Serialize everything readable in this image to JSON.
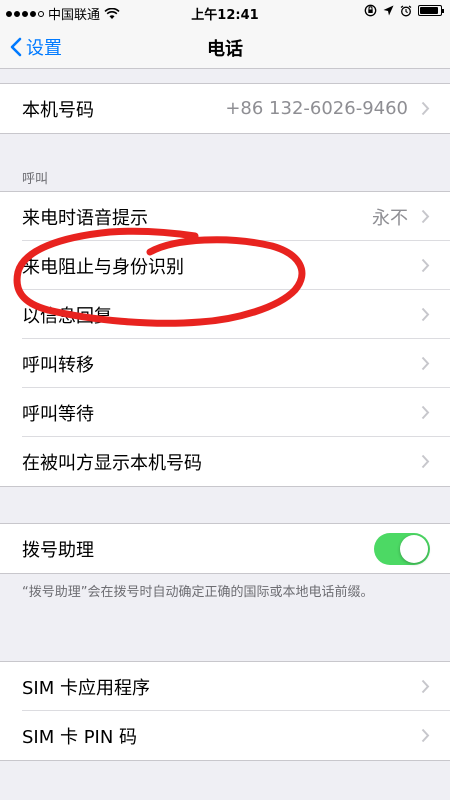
{
  "status_bar": {
    "carrier": "中国联通",
    "time": "上午12:41",
    "battery_level": 0.9
  },
  "nav": {
    "back_label": "设置",
    "title": "电话"
  },
  "my_number": {
    "label": "本机号码",
    "value": "+86 132-6026-9460"
  },
  "calls": {
    "header": "呼叫",
    "rows": [
      {
        "label": "来电时语音提示",
        "value": "永不"
      },
      {
        "label": "来电阻止与身份识别"
      },
      {
        "label": "以信息回复"
      },
      {
        "label": "呼叫转移"
      },
      {
        "label": "呼叫等待"
      },
      {
        "label": "在被叫方显示本机号码"
      }
    ]
  },
  "dial_assist": {
    "label": "拨号助理",
    "enabled": true,
    "footnote": "“拨号助理”会在拨号时自动确定正确的国际或本地电话前缀。"
  },
  "sim": {
    "rows": [
      {
        "label": "SIM 卡应用程序"
      },
      {
        "label": "SIM 卡 PIN 码"
      }
    ]
  },
  "colors": {
    "accent": "#007aff",
    "toggle_on": "#4cd964",
    "annotation": "#e8231f"
  }
}
